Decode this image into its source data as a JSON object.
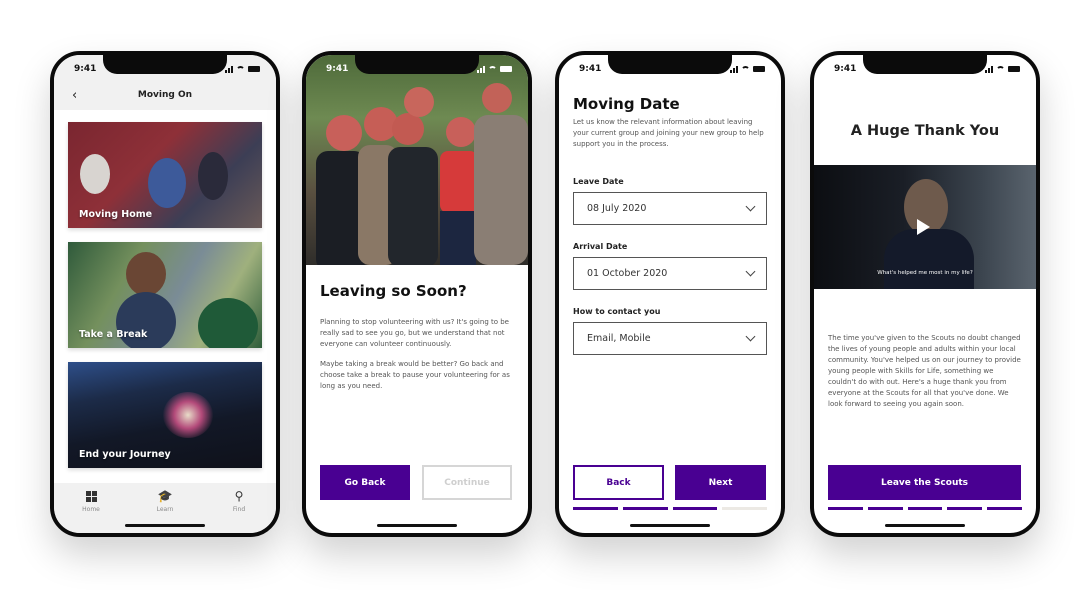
{
  "status_time": "9:41",
  "colors": {
    "brand_purple": "#490092",
    "disabled_border": "#d6d6d6",
    "progress_inactive": "#ece9e4"
  },
  "screen1": {
    "header_title": "Moving On",
    "back_icon": "chevron-left-icon",
    "cards": [
      {
        "label": "Moving Home"
      },
      {
        "label": "Take a Break"
      },
      {
        "label": "End your Journey"
      }
    ],
    "tabs": [
      {
        "label": "Home",
        "icon": "dashboard-grid-icon"
      },
      {
        "label": "Learn",
        "icon": "graduation-cap-icon"
      },
      {
        "label": "Find",
        "icon": "search-icon"
      }
    ]
  },
  "screen2": {
    "title": "Leaving so Soon?",
    "paragraphs": [
      "Planning to stop volunteering with us? It's going to be really sad to see you go, but we understand that not everyone can volunteer continuously.",
      "Maybe taking a break would be better? Go back and choose take a break to pause your volunteering for as long as you need."
    ],
    "primary_button": "Go Back",
    "secondary_button": "Continue"
  },
  "screen3": {
    "title": "Moving Date",
    "description": "Let us know the relevant information about leaving your current group and joining your new group to help support you in the process.",
    "fields": [
      {
        "label": "Leave Date",
        "value": "08 July 2020"
      },
      {
        "label": "Arrival Date",
        "value": "01 October 2020"
      },
      {
        "label": "How to contact you",
        "value": "Email, Mobile"
      }
    ],
    "back_button": "Back",
    "next_button": "Next",
    "progress": {
      "completed_steps": 3,
      "total_steps": 4
    }
  },
  "screen4": {
    "title": "A Huge Thank You",
    "video_caption": "What's helped me most in my life?",
    "body": "The time you've given to the Scouts no doubt changed the lives of young people and adults within your local community. You've helped us on our journey to provide young people with Skills for Life, something we couldn't do with out. Here's a huge thank you from everyone at the Scouts for all that you've done. We look forward to seeing you again soon.",
    "button": "Leave the Scouts",
    "progress": {
      "completed_steps": 5,
      "total_steps": 5
    }
  }
}
